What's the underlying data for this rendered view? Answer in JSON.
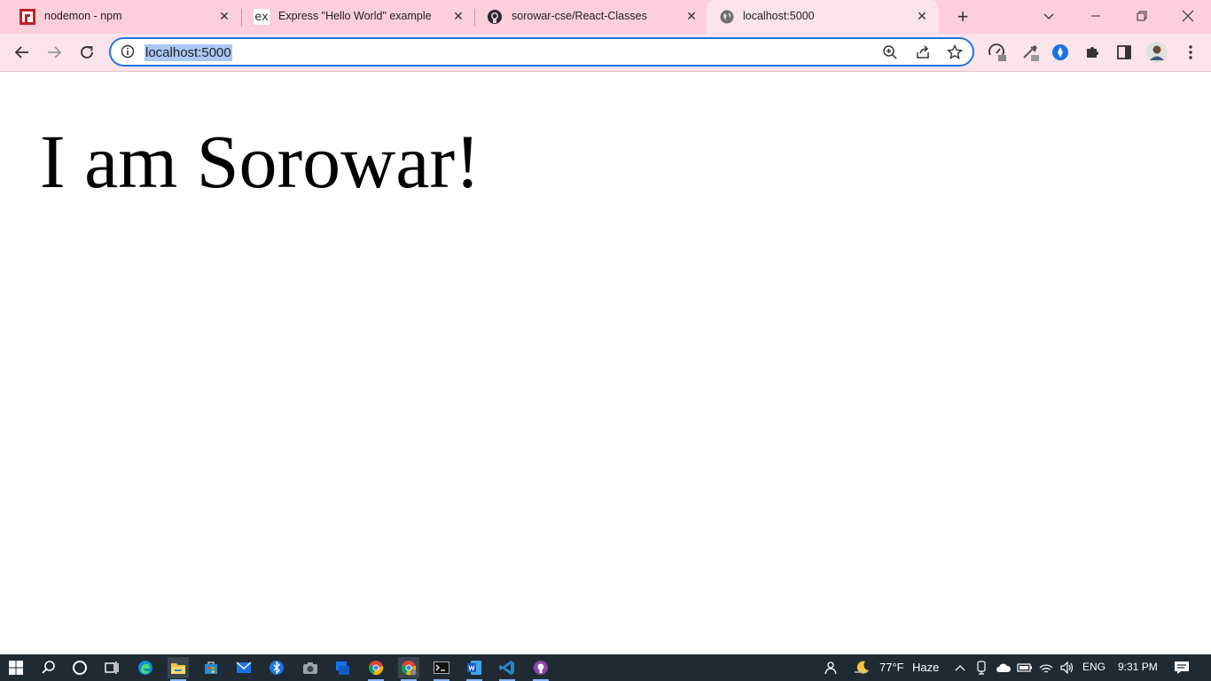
{
  "tabs": [
    {
      "title": "nodemon - npm",
      "favicon": "npm-icon",
      "active": false
    },
    {
      "title": "Express \"Hello World\" example",
      "favicon": "express-icon",
      "active": false
    },
    {
      "title": "sorowar-cse/React-Classes",
      "favicon": "github-icon",
      "active": false
    },
    {
      "title": "localhost:5000",
      "favicon": "globe-icon",
      "active": true
    }
  ],
  "omnibox": {
    "url": "localhost:5000"
  },
  "page": {
    "heading": "I am Sorowar!"
  },
  "taskbar": {
    "weather_temp": "77°F",
    "weather_desc": "Haze",
    "language": "ENG",
    "time": "9:31 PM"
  },
  "colors": {
    "tab_strip": "#fccfdb",
    "toolbar": "#fde3ea",
    "omnibox_border": "#1a73e8",
    "url_selection": "#aac9f5",
    "taskbar": "#1f2a33"
  }
}
